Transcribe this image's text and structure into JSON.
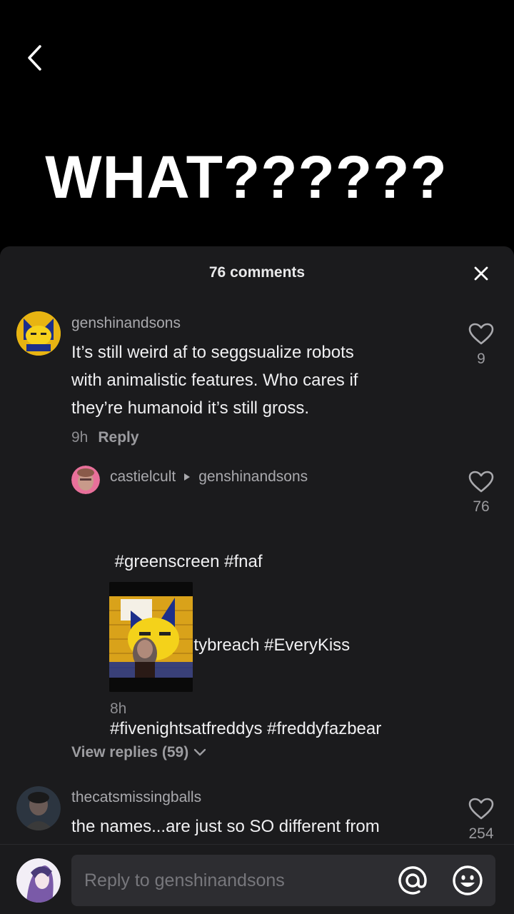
{
  "video": {
    "overlay_text": "WHAT??????"
  },
  "sheet": {
    "count_label": "76 comments"
  },
  "comments": [
    {
      "username": "genshinandsons",
      "text_lines": [
        "It’s still weird af to seggsualize robots",
        "with animalistic features. Who cares if",
        "they’re humanoid it’s still gross."
      ],
      "time": "9h",
      "reply_label": "Reply",
      "likes": "9"
    },
    {
      "username": "castielcult",
      "reply_to": "genshinandsons",
      "text_lines": [
        " #greenscreen #fnaf",
        "#fnafsecuritybreach #EveryKiss",
        "#fivenightsatfreddys #freddyfazbear"
      ],
      "time": "8h",
      "likes": "76"
    },
    {
      "username": "thecatsmissingballs",
      "text_lines": [
        "the names...are just so SO different from"
      ],
      "likes": "254"
    }
  ],
  "view_replies_label": "View replies (59)",
  "composer": {
    "placeholder": "Reply to genshinandsons"
  },
  "icons": {
    "back": "chevron-left-icon",
    "close": "close-icon",
    "like": "heart-outline-icon",
    "mention": "at-sign-icon",
    "emoji": "smiley-icon"
  },
  "colors": {
    "sheet_bg": "#1b1b1d",
    "input_bg": "#2d2d31",
    "muted": "#a9a9ad"
  }
}
